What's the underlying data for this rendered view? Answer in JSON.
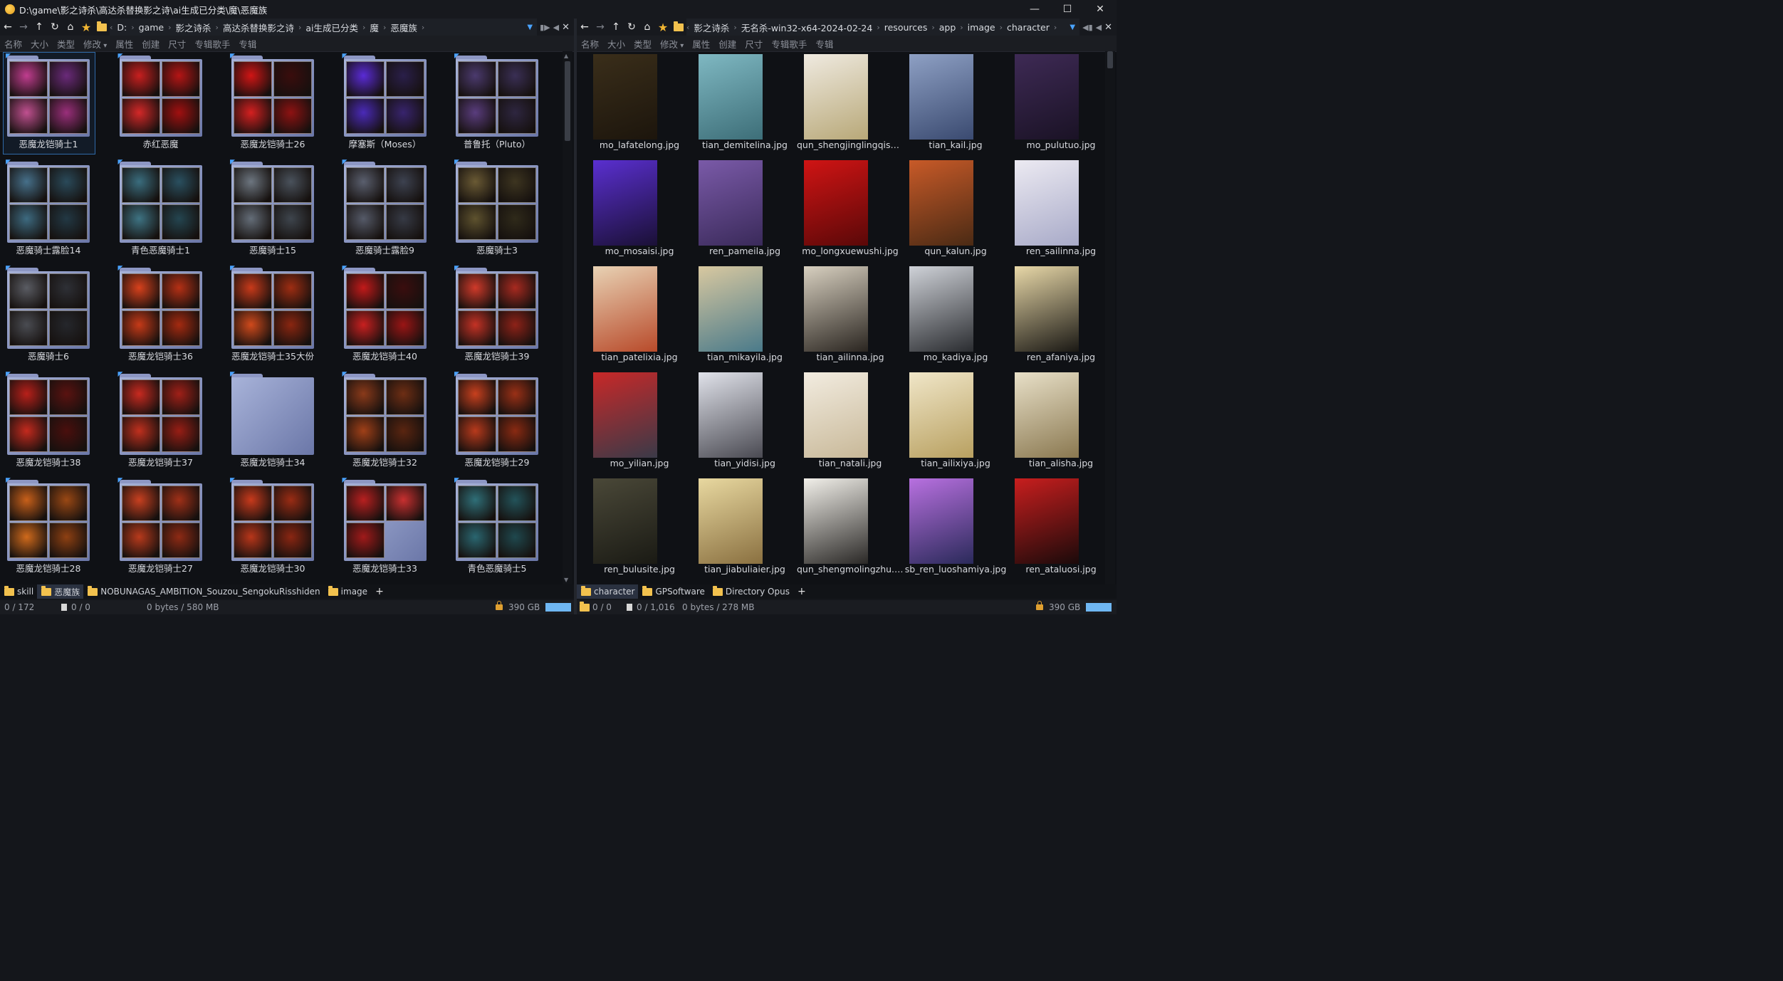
{
  "window": {
    "title": "D:\\game\\影之诗杀\\高达杀替换影之诗\\ai生成已分类\\魔\\恶魔族",
    "controls": [
      "—",
      "☐",
      "✕"
    ]
  },
  "left": {
    "breadcrumbs": [
      "D:",
      "game",
      "影之诗杀",
      "高达杀替换影之诗",
      "ai生成已分类",
      "魔",
      "恶魔族"
    ],
    "columns": [
      "名称",
      "大小",
      "类型",
      "修改",
      "属性",
      "创建",
      "尺寸",
      "专辑歌手",
      "专辑"
    ],
    "sort_column": "修改",
    "folders": [
      {
        "name": "恶魔龙铠骑士1",
        "c": [
          "#c03d8f",
          "#6a2a7a",
          "#c05090",
          "#9a2f7b"
        ],
        "selected": true
      },
      {
        "name": "赤红恶魔",
        "c": [
          "#c81f1f",
          "#b51515",
          "#d42828",
          "#a11010"
        ]
      },
      {
        "name": "恶魔龙铠骑士26",
        "c": [
          "#d01515",
          "#3a0d0d",
          "#d52020",
          "#8e1212"
        ]
      },
      {
        "name": "摩塞斯（Moses）",
        "c": [
          "#5a2bd6",
          "#2a1f4a",
          "#4a2ab8",
          "#38246e"
        ]
      },
      {
        "name": "普鲁托（Pluto）",
        "c": [
          "#4b3a6e",
          "#3a2f55",
          "#5a3d7e",
          "#2e2640"
        ]
      },
      {
        "name": "恶魔骑士露脸14",
        "c": [
          "#46708a",
          "#2a4a5a",
          "#3d6a80",
          "#223844"
        ]
      },
      {
        "name": "青色恶魔骑士1",
        "c": [
          "#3a6d7e",
          "#2a5060",
          "#3e7383",
          "#244550"
        ]
      },
      {
        "name": "恶魔骑士15",
        "c": [
          "#6d7680",
          "#4a525c",
          "#646d78",
          "#3e454d"
        ]
      },
      {
        "name": "恶魔骑士露脸9",
        "c": [
          "#5a5f6e",
          "#3d4250",
          "#555a68",
          "#363a45"
        ]
      },
      {
        "name": "恶魔骑士3",
        "c": [
          "#6a5a34",
          "#3d3520",
          "#5e522e",
          "#2f2a1a"
        ]
      },
      {
        "name": "恶魔骑士6",
        "c": [
          "#5a5c63",
          "#2e3036",
          "#4a4c52",
          "#25272c"
        ]
      },
      {
        "name": "恶魔龙铠骑士36",
        "c": [
          "#d8411c",
          "#b53015",
          "#c63a18",
          "#a42a10"
        ]
      },
      {
        "name": "恶魔龙铠骑士35大份",
        "c": [
          "#c83a1a",
          "#9e2d12",
          "#d04a1c",
          "#8a2610"
        ]
      },
      {
        "name": "恶魔龙铠骑士40",
        "c": [
          "#c21a1a",
          "#3a0e0e",
          "#c82020",
          "#9a1515"
        ]
      },
      {
        "name": "恶魔龙铠骑士39",
        "c": [
          "#d03a2a",
          "#a82a20",
          "#c43225",
          "#8e2218"
        ]
      },
      {
        "name": "恶魔龙铠骑士38",
        "c": [
          "#b8201a",
          "#5a1210",
          "#c42a1e",
          "#4a0f0d"
        ]
      },
      {
        "name": "恶魔龙铠骑士37",
        "c": [
          "#c82a20",
          "#a02018",
          "#c0301e",
          "#981e15"
        ]
      },
      {
        "name": "恶魔龙铠骑士34",
        "c": [],
        "empty": true
      },
      {
        "name": "恶魔龙铠骑士32",
        "c": [
          "#8a3a1a",
          "#6e2e14",
          "#a04018",
          "#5a2510"
        ]
      },
      {
        "name": "恶魔龙铠骑士29",
        "c": [
          "#c8401e",
          "#9a3016",
          "#b83a1c",
          "#8a2a12"
        ]
      },
      {
        "name": "恶魔龙铠骑士28",
        "c": [
          "#c8601a",
          "#9a4814",
          "#d06a1c",
          "#8e4012"
        ]
      },
      {
        "name": "恶魔龙铠骑士27",
        "c": [
          "#c84020",
          "#a03018",
          "#b83a1c",
          "#8e2a14"
        ]
      },
      {
        "name": "恶魔龙铠骑士30",
        "c": [
          "#c83a1c",
          "#9a2c14",
          "#b8361a",
          "#8a2612"
        ]
      },
      {
        "name": "恶魔龙铠骑士33",
        "c": [
          "#b82020",
          "#c83030",
          "#a01a1a",
          ""
        ]
      },
      {
        "name": "青色恶魔骑士5",
        "c": [
          "#2f6f78",
          "#23535a",
          "#2a6670",
          "#1f484e"
        ]
      }
    ],
    "tabs": [
      "skill",
      "恶魔族",
      "NOBUNAGAS_AMBITION_Souzou_SengokuRisshiden",
      "image"
    ],
    "active_tab": 1,
    "status": {
      "selection": "0 / 172",
      "files": "0 / 0",
      "bytes": "0 bytes / 580 MB",
      "free": "390 GB"
    }
  },
  "right": {
    "breadcrumbs": [
      "影之诗杀",
      "无名杀-win32-x64-2024-02-24",
      "resources",
      "app",
      "image",
      "character"
    ],
    "columns": [
      "名称",
      "大小",
      "类型",
      "修改",
      "属性",
      "创建",
      "尺寸",
      "专辑歌手",
      "专辑"
    ],
    "sort_column": "修改",
    "files": [
      {
        "name": "mo_lafatelong.jpg",
        "c": [
          "#3a2e1a",
          "#1c150c"
        ]
      },
      {
        "name": "tian_demitelina.jpg",
        "c": [
          "#7fb8c2",
          "#3d6e78"
        ]
      },
      {
        "name": "qun_shengjinglingqishit...",
        "c": [
          "#efeae0",
          "#b8a878"
        ]
      },
      {
        "name": "tian_kail.jpg",
        "c": [
          "#8ea0c4",
          "#3a4a70"
        ]
      },
      {
        "name": "mo_pulutuo.jpg",
        "c": [
          "#3e2a55",
          "#1a1225"
        ]
      },
      {
        "name": "mo_mosaisi.jpg",
        "c": [
          "#5a2fd0",
          "#1a1035"
        ]
      },
      {
        "name": "ren_pameila.jpg",
        "c": [
          "#7a5aa8",
          "#3a2a5a"
        ]
      },
      {
        "name": "mo_longxuewushi.jpg",
        "c": [
          "#d01414",
          "#5a0808"
        ]
      },
      {
        "name": "qun_kalun.jpg",
        "c": [
          "#c85a28",
          "#4a2a14"
        ]
      },
      {
        "name": "ren_sailinna.jpg",
        "c": [
          "#eceaf2",
          "#a8aac8"
        ]
      },
      {
        "name": "tian_patelixia.jpg",
        "c": [
          "#e8d2b4",
          "#b84a2a"
        ]
      },
      {
        "name": "tian_mikayila.jpg",
        "c": [
          "#d8c8a0",
          "#4a7a8a"
        ]
      },
      {
        "name": "tian_ailinna.jpg",
        "c": [
          "#d8d0c0",
          "#2a2520"
        ]
      },
      {
        "name": "mo_kadiya.jpg",
        "c": [
          "#cfd2d8",
          "#2a2c30"
        ]
      },
      {
        "name": "ren_afaniya.jpg",
        "c": [
          "#e8d8a8",
          "#1a1814"
        ]
      },
      {
        "name": "mo_yilian.jpg",
        "c": [
          "#c82828",
          "#3a3a48"
        ]
      },
      {
        "name": "tian_yidisi.jpg",
        "c": [
          "#e0e2ea",
          "#4a4a52"
        ]
      },
      {
        "name": "tian_natali.jpg",
        "c": [
          "#f2ece0",
          "#c8b898"
        ]
      },
      {
        "name": "tian_ailixiya.jpg",
        "c": [
          "#f0e6c8",
          "#b8a060"
        ]
      },
      {
        "name": "tian_alisha.jpg",
        "c": [
          "#e8e0c8",
          "#8a7850"
        ]
      },
      {
        "name": "ren_bulusite.jpg",
        "c": [
          "#4a4838",
          "#1a1a14"
        ]
      },
      {
        "name": "tian_jiabuliaier.jpg",
        "c": [
          "#e8d8a0",
          "#8a7040"
        ]
      },
      {
        "name": "qun_shengmolingzhu.jpg",
        "c": [
          "#f2f0ea",
          "#2a2826"
        ]
      },
      {
        "name": "sb_ren_luoshamiya.jpg",
        "c": [
          "#b870e0",
          "#2a2a5a"
        ]
      },
      {
        "name": "ren_ataluosi.jpg",
        "c": [
          "#c81e1e",
          "#1a0a0a"
        ]
      }
    ],
    "tabs": [
      "character",
      "GPSoftware",
      "Directory Opus"
    ],
    "active_tab": 0,
    "status": {
      "selection": "0 / 0",
      "files": "0 / 1,016",
      "bytes": "0 bytes / 278 MB",
      "free": "390 GB"
    }
  }
}
